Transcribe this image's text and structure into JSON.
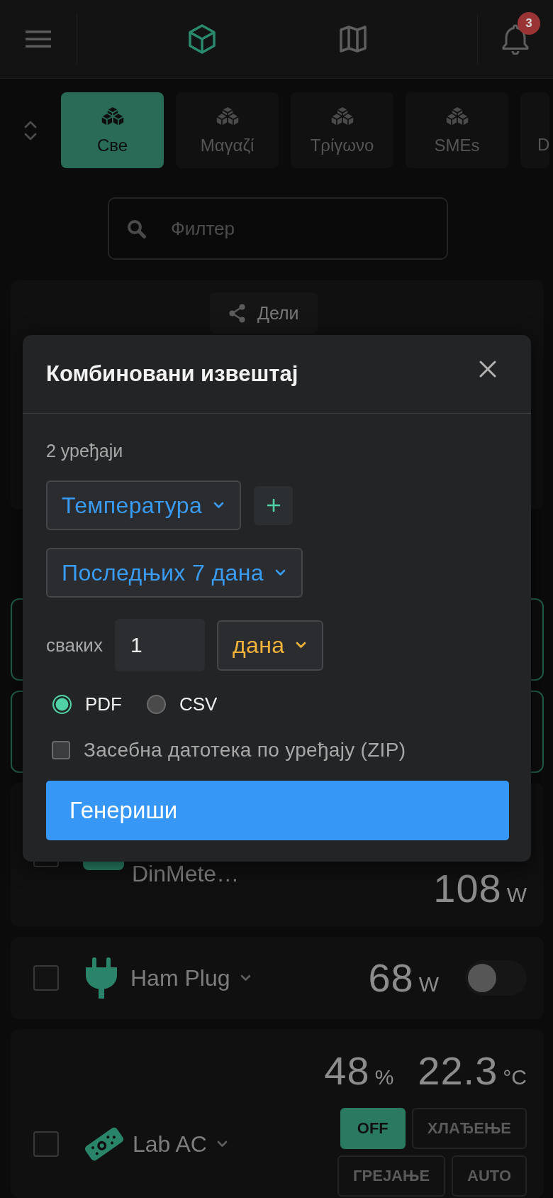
{
  "header": {
    "nav": [
      {
        "kind": "cube",
        "selected": true
      },
      {
        "kind": "map",
        "selected": false
      }
    ],
    "notifications": "3"
  },
  "groups": [
    {
      "label": "Све",
      "selected": true
    },
    {
      "label": "Μαγαζί",
      "selected": false
    },
    {
      "label": "Τρίγωνο",
      "selected": false
    },
    {
      "label": "SMEs",
      "selected": false
    },
    {
      "label": "D",
      "selected": false
    }
  ],
  "filter": {
    "placeholder": "Филтер"
  },
  "share_button": {
    "label": "Дели"
  },
  "devices": [
    {
      "kind": "covered",
      "selected": true
    },
    {
      "kind": "covered",
      "selected": true
    },
    {
      "kind": "meter",
      "selected": false,
      "checked": false,
      "name": "DinMete…",
      "reading": "108",
      "unit": "W"
    },
    {
      "kind": "plug",
      "selected": false,
      "checked": false,
      "name": "Ham Plug",
      "reading": "68",
      "unit": "W",
      "on": false
    },
    {
      "kind": "ac",
      "selected": false,
      "checked": false,
      "name": "Lab AC",
      "humidity": "48",
      "humidity_unit": "%",
      "temperature": "22.3",
      "temperature_unit": "°C",
      "modes": [
        {
          "label": "OFF",
          "selected": true
        },
        {
          "label": "ХЛАЂЕЊЕ",
          "selected": false
        },
        {
          "label": "ГРЕЈАЊЕ",
          "selected": false
        },
        {
          "label": "AUTO",
          "selected": false
        }
      ]
    }
  ],
  "dialog": {
    "title": "Комбиновани извештај",
    "device_count": "2 уређаји",
    "metrics": [
      "Температура"
    ],
    "range": "Последњих 7 дана",
    "interval_label": "сваких",
    "interval_value": "1",
    "interval_unit": "дана",
    "formats": [
      {
        "label": "PDF",
        "selected": true
      },
      {
        "label": "CSV",
        "selected": false
      }
    ],
    "separate_files": {
      "label": "Засебна датотека по уређају (ZIP)",
      "checked": false
    },
    "submit": "Генериши"
  }
}
